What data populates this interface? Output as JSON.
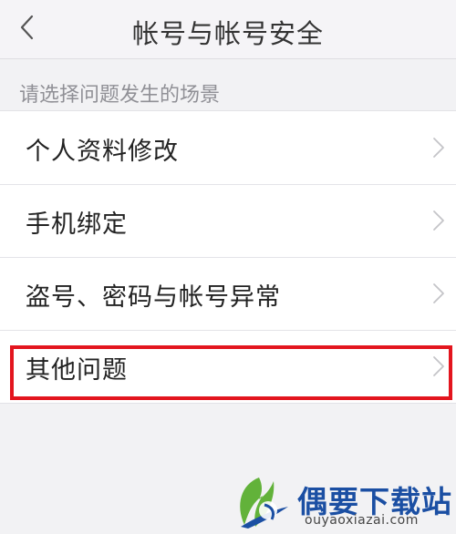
{
  "header": {
    "title": "帐号与帐号安全",
    "back_icon": "chevron-left-icon"
  },
  "section_header": "请选择问题发生的场景",
  "items": [
    {
      "label": "个人资料修改",
      "icon": "chevron-right-icon"
    },
    {
      "label": "手机绑定",
      "icon": "chevron-right-icon"
    },
    {
      "label": "盗号、密码与帐号异常",
      "icon": "chevron-right-icon"
    },
    {
      "label": "其他问题",
      "icon": "chevron-right-icon"
    }
  ],
  "highlight": {
    "target": "其他问题",
    "color": "#e3151e"
  },
  "watermark": {
    "title": "偶要下载站",
    "url": "ouyaoxiazai.com"
  },
  "colors": {
    "background": "#f2f2f4",
    "list_background": "#ffffff",
    "watermark_blue": "#1b4fa3",
    "watermark_green": "#62b23a"
  }
}
